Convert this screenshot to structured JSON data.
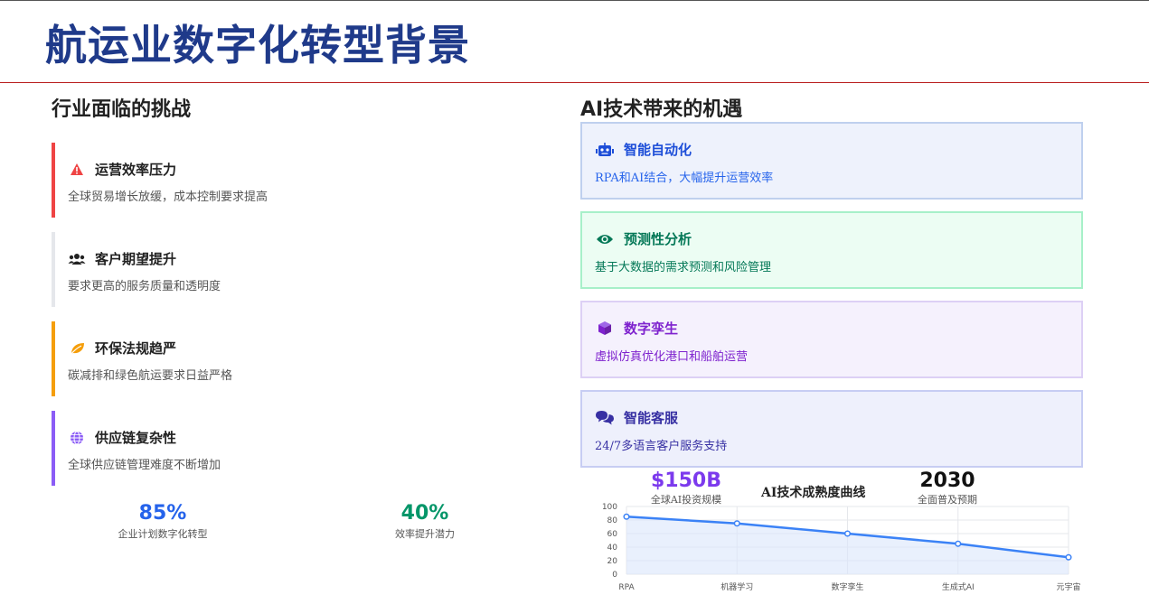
{
  "title": "航运业数字化转型背景",
  "left": {
    "heading": "行业面临的挑战",
    "challenges": [
      {
        "title": "运营效率压力",
        "desc": "全球贸易增长放缓，成本控制要求提高",
        "icon": "warning-icon",
        "color": "#ef4444"
      },
      {
        "title": "客户期望提升",
        "desc": "要求更高的服务质量和透明度",
        "icon": "users-icon",
        "color": "#e5e7eb"
      },
      {
        "title": "环保法规趋严",
        "desc": "碳减排和绿色航运要求日益严格",
        "icon": "leaf-icon",
        "color": "#f59e0b"
      },
      {
        "title": "供应链复杂性",
        "desc": "全球供应链管理难度不断增加",
        "icon": "globe-icon",
        "color": "#8b5cf6"
      }
    ],
    "stats": [
      {
        "value": "85%",
        "label": "企业计划数字化转型",
        "color": "#2563eb"
      },
      {
        "value": "40%",
        "label": "效率提升潜力",
        "color": "#059669"
      }
    ]
  },
  "right": {
    "heading_ai": "AI",
    "heading_rest": "技术带来的机遇",
    "opportunities": [
      {
        "title": "智能自动化",
        "desc": "RPA和AI结合，大幅提升运营效率",
        "icon": "robot-icon",
        "accent": "#1d4ed8",
        "bg": "#eef2fc",
        "border": "#bfd0ee"
      },
      {
        "title": "预测性分析",
        "desc": "基于大数据的需求预测和风险管理",
        "icon": "eye-icon",
        "accent": "#047857",
        "bg": "#ecfdf3",
        "border": "#a7f0c9"
      },
      {
        "title": "数字孪生",
        "desc": "虚拟仿真优化港口和船舶运营",
        "icon": "cube-icon",
        "accent": "#7e22ce",
        "bg": "#f5f1fd",
        "border": "#ddd0f5"
      },
      {
        "title": "智能客服",
        "desc": "24/7多语言客户服务支持",
        "icon": "chat-icon",
        "accent": "#3730a3",
        "bg": "#eef0fc",
        "border": "#c7cdf3"
      }
    ],
    "stats": [
      {
        "value": "$150B",
        "label": "全球AI投资规模",
        "color": "#7c3aed"
      },
      {
        "value": "2030",
        "label": "全面普及预期",
        "color": "#111111"
      }
    ]
  },
  "chart_data": {
    "type": "area",
    "title": "AI技术成熟度曲线",
    "categories": [
      "RPA",
      "机器学习",
      "数字孪生",
      "生成式AI",
      "元宇宙"
    ],
    "values": [
      85,
      75,
      60,
      45,
      25
    ],
    "yticks": [
      0,
      20,
      40,
      60,
      80,
      100
    ],
    "ylim": [
      0,
      100
    ],
    "grid": true,
    "line_color": "#3b82f6",
    "fill_color": "#dbe6fb"
  }
}
